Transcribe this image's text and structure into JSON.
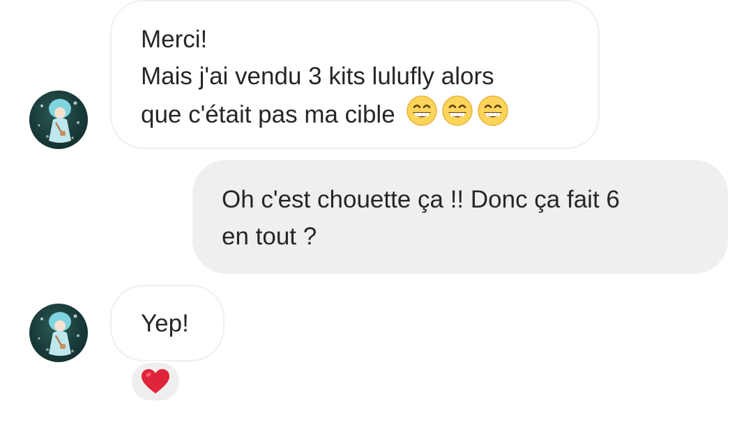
{
  "conversation": {
    "messages": [
      {
        "sender": "contact",
        "lines": [
          "Merci!",
          "Mais j'ai vendu 3 kits lulufly alors",
          "que c'était pas ma cible"
        ],
        "emojis": [
          "grinning-face-with-smiling-eyes-icon",
          "grinning-face-with-smiling-eyes-icon",
          "grinning-face-with-smiling-eyes-icon"
        ]
      },
      {
        "sender": "me",
        "lines": [
          "Oh c'est chouette ça !! Donc ça fait 6",
          "en tout ?"
        ]
      },
      {
        "sender": "contact",
        "lines": [
          "Yep!"
        ],
        "reaction": "red-heart-icon"
      }
    ]
  },
  "colors": {
    "incoming_border": "#efefef",
    "outgoing_bubble": "#efefef",
    "text": "#262626",
    "heart": "#e0243a"
  }
}
